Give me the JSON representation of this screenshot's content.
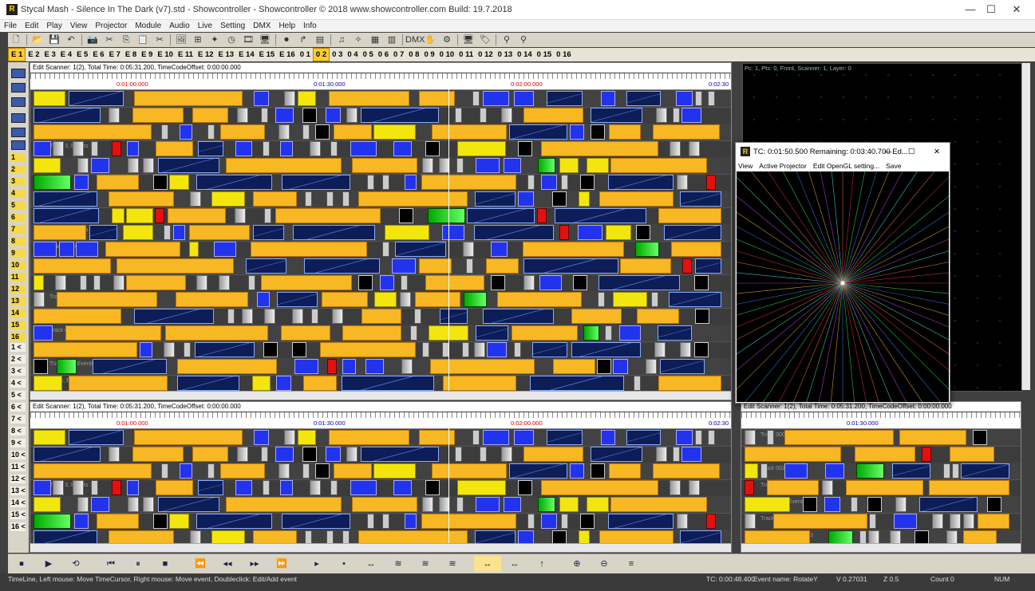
{
  "window": {
    "title": "Stycal Mash - Silence In The Dark (v7).std - Showcontroller - Showcontroller © 2018 www.showcontroller.com  Build: 19.7.2018",
    "app_icon": "R",
    "controls": {
      "minimize": "—",
      "maximize": "☐",
      "close": "✕"
    }
  },
  "menu": [
    "File",
    "Edit",
    "Play",
    "View",
    "Projector",
    "Module",
    "Audio",
    "Live",
    "Setting",
    "DMX",
    "Help",
    "Info"
  ],
  "toolbar": {
    "icons": [
      "new-icon",
      "open-icon",
      "save-icon",
      "undo-icon",
      "camera-icon",
      "cut-icon",
      "copy-icon",
      "paste-icon",
      "cut-scene-icon",
      "image-icon",
      "grid-icon",
      "wand-icon",
      "clock-icon",
      "film-icon",
      "monitor-icon",
      "record-icon",
      "arrow-icon",
      "bars-icon",
      "music-icon",
      "star-icon",
      "layout-icon",
      "eq-icon",
      "dmx-icon",
      "hand-icon",
      "tool-icon",
      "monitor2-icon",
      "tag-icon",
      "binoculars-icon",
      "binoculars2-icon"
    ],
    "glyphs": [
      "🗋",
      "📂",
      "💾",
      "↶",
      "📷",
      "✂",
      "⎘",
      "📋",
      "✂",
      "🖼",
      "⊞",
      "✦",
      "◷",
      "🎞",
      "🖥",
      "⏺",
      "↱",
      "▤",
      "♫",
      "✧",
      "▦",
      "▥",
      "DMX",
      "✋",
      "⚙",
      "🖥",
      "🏷",
      "⚲",
      "⚲"
    ]
  },
  "tabs": [
    "E 1",
    "E 2",
    "E 3",
    "E 4",
    "E 5",
    "E 6",
    "E 7",
    "E 8",
    "E 9",
    "E 10",
    "E 11",
    "E 12",
    "E 13",
    "E 14",
    "E 15",
    "E 16",
    "0 1",
    "0 2",
    "0 3",
    "0 4",
    "0 5",
    "0 6",
    "0 7",
    "0 8",
    "0 9",
    "0 10",
    "0 11",
    "0 12",
    "0 13",
    "0 14",
    "0 15",
    "0 16"
  ],
  "active_tab": "E 1",
  "highlight_tab": "0 2",
  "gutter_numbers": [
    "1",
    "2",
    "3",
    "4",
    "5",
    "6",
    "7",
    "8",
    "9",
    "10",
    "11",
    "12",
    "13",
    "14",
    "15",
    "16"
  ],
  "gutter_lt": [
    "1 <",
    "2 <",
    "3 <",
    "4 <",
    "5 <",
    "6 <",
    "7 <",
    "8 <",
    "9 <",
    "10 <",
    "11 <",
    "12 <",
    "13 <",
    "14 <",
    "15 <",
    "16 <"
  ],
  "top_pane": {
    "header": "Edit Scanner: 1(2), Total Time: 0:05:31.200, TimeCodeOffset: 0:00:00.000",
    "ruler": [
      "0:01:00.000",
      "0:01:30.000",
      "0:02:00.000",
      "0:02:30"
    ],
    "track_labels": [
      "",
      "Track 1, Events 15",
      "Track 2, Events 10",
      "Track 3, Events 10",
      "",
      "",
      "",
      "Track 7, Events 14",
      "Track 8, Events 13",
      "Track 9, Events 14",
      "Track 10, Events 15",
      "",
      "Track 12, Events 13",
      "Track 13, Events 12",
      "Track 0:13, Events 11",
      "",
      "Track 016, Events 11",
      "Track, Events 14"
    ]
  },
  "bottom_pane": {
    "header": "Edit Scanner: 1(2), Total Time: 0:05:31.200, TimeCodeOffset: 0:00:00.000",
    "ruler": [
      "0:01:00.000",
      "0:01:30.000",
      "0:02:00.000",
      "0:02:30"
    ],
    "track_labels": [
      "",
      "Track 1, Events 15",
      "Track 2, Events 15",
      "Track 3, Events 10",
      "",
      "",
      "Track 6, Events 14"
    ]
  },
  "right_pane": {
    "header": "Edit Scanner: 1(2), Total Time: 0:05:31.200, TimeCodeOffset: 0:00:00.000",
    "ruler": [
      "0:01:30.000"
    ],
    "track_labels": [
      "Track 000",
      "Track 001",
      "Track 002",
      "Track 003",
      "Track 004, Events 14",
      "Track 005",
      "Track 006, Events 13"
    ]
  },
  "preview": {
    "label": "Pc: 1, Pts: 0, Front, Scanner: 1, Layer: 0"
  },
  "float_window": {
    "title": "TC: 0:01:50.500  Remaining: 0:03:40.700  Ed...",
    "icon": "R",
    "menu": [
      "View",
      "Active Projector",
      "Edit OpenGL setting...",
      "Save"
    ],
    "controls": {
      "minimize": "—",
      "maximize": "☐",
      "close": "✕"
    }
  },
  "transport": {
    "icons": [
      "stop-start-icon",
      "play-start-icon",
      "loop-icon",
      "skip-back-icon",
      "pause-icon",
      "stop-icon",
      "rewind-fast-icon",
      "rewind-icon",
      "forward-icon",
      "forward-fast-icon",
      "marker-icon",
      "dot-icon",
      "range-icon",
      "wave-icon",
      "wave2-icon",
      "wave3-icon",
      "expand-icon",
      "expand2-icon",
      "jump-icon",
      "zoom-in-icon",
      "zoom-out-icon",
      "fit-icon"
    ],
    "glyphs": [
      "⏹",
      "▶",
      "⟲",
      "⏮",
      "⏸",
      "■",
      "⏪",
      "◂◂",
      "▸▸",
      "⏩",
      "▸",
      "•",
      "↔",
      "≋",
      "≋",
      "≋",
      "↔",
      "↔",
      "↑",
      "⊕",
      "⊖",
      "≡"
    ]
  },
  "status": {
    "hint": "TimeLine, Left mouse: Move TimeCursor, Right mouse: Move event, Doubleclick: Edit/Add event",
    "tc": "TC: 0:00:48.400",
    "event_name": "Event name: RotateY",
    "v": "V 0.27031",
    "z": "Z 0.5",
    "count": "Count 0",
    "num": "NUM"
  }
}
